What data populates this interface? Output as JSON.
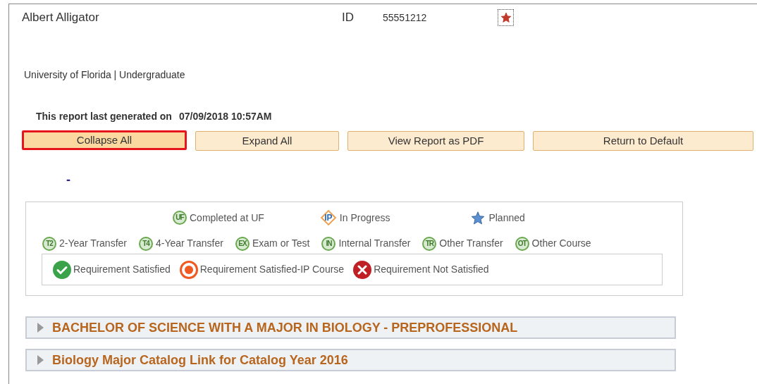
{
  "student": {
    "name": "Albert Alligator",
    "id_label": "ID",
    "id_value": "55551212",
    "starred": true
  },
  "institution": "University of Florida | Undergraduate",
  "report": {
    "label": "This report last generated on",
    "value": "07/09/2018 10:57AM"
  },
  "buttons": [
    {
      "label": "Collapse All",
      "selected": true
    },
    {
      "label": "Expand All",
      "selected": false
    },
    {
      "label": "View Report as PDF",
      "selected": false
    },
    {
      "label": "Return to Default",
      "selected": false
    }
  ],
  "dash": "-",
  "legend": {
    "top_row": [
      {
        "kind": "circle",
        "code": "UF",
        "label": "Completed at UF"
      },
      {
        "kind": "diamond",
        "code": "IP",
        "label": "In Progress"
      },
      {
        "kind": "star",
        "label": "Planned"
      }
    ],
    "second_row": [
      {
        "kind": "circle",
        "code": "T2",
        "label": "2-Year Transfer"
      },
      {
        "kind": "circle",
        "code": "T4",
        "label": "4-Year Transfer"
      },
      {
        "kind": "circle",
        "code": "EX",
        "label": "Exam or Test"
      },
      {
        "kind": "circle",
        "code": "IN",
        "label": "Internal Transfer"
      },
      {
        "kind": "circle",
        "code": "TR",
        "label": "Other Transfer"
      },
      {
        "kind": "circle",
        "code": "OT",
        "label": "Other Course"
      }
    ],
    "status": [
      {
        "kind": "check",
        "label": "Requirement Satisfied"
      },
      {
        "kind": "ring",
        "label": "Requirement Satisfied-IP Course"
      },
      {
        "kind": "cross",
        "label": "Requirement Not Satisfied"
      }
    ]
  },
  "sections": [
    {
      "title": "BACHELOR OF SCIENCE WITH A MAJOR IN BIOLOGY - PREPROFESSIONAL",
      "expanded": false
    },
    {
      "title": "Biology Major Catalog Link for Catalog Year 2016",
      "expanded": false
    }
  ]
}
